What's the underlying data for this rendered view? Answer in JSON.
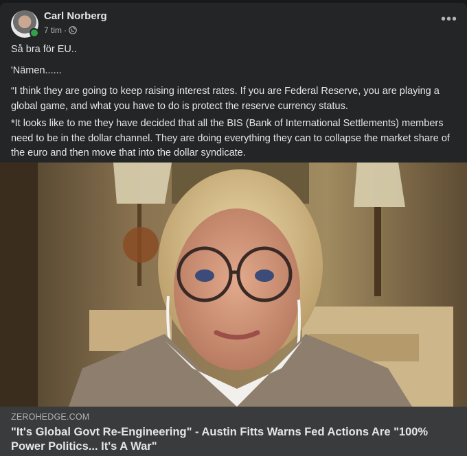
{
  "post": {
    "author": "Carl Norberg",
    "time": "7 tim",
    "time_separator": "·",
    "privacy_icon": "globe-icon",
    "more_icon": "more-options-icon",
    "more_label": "•••",
    "paragraphs": [
      "Så bra för EU..",
      "'Nämen......",
      "“I think they are going to keep raising interest rates.  If you are Federal Reserve, you are playing a global game, and what you have to do is protect the reserve currency status.",
      "*It looks like to me they have decided that all the BIS (Bank of International Settlements) members need to be in the dollar channel.  They are doing everything they can to collapse the market share of the euro and then move that into the dollar syndicate."
    ]
  },
  "link": {
    "domain": "ZEROHEDGE.COM",
    "title": "\"It's Global Govt Re-Engineering\" - Austin Fitts Warns Fed Actions Are \"100% Power Politics... It's A War\""
  },
  "colors": {
    "card_bg": "#242526",
    "link_bg": "#3a3b3c",
    "text_primary": "#e4e6eb",
    "text_secondary": "#b0b3b8",
    "online": "#31a24c"
  }
}
